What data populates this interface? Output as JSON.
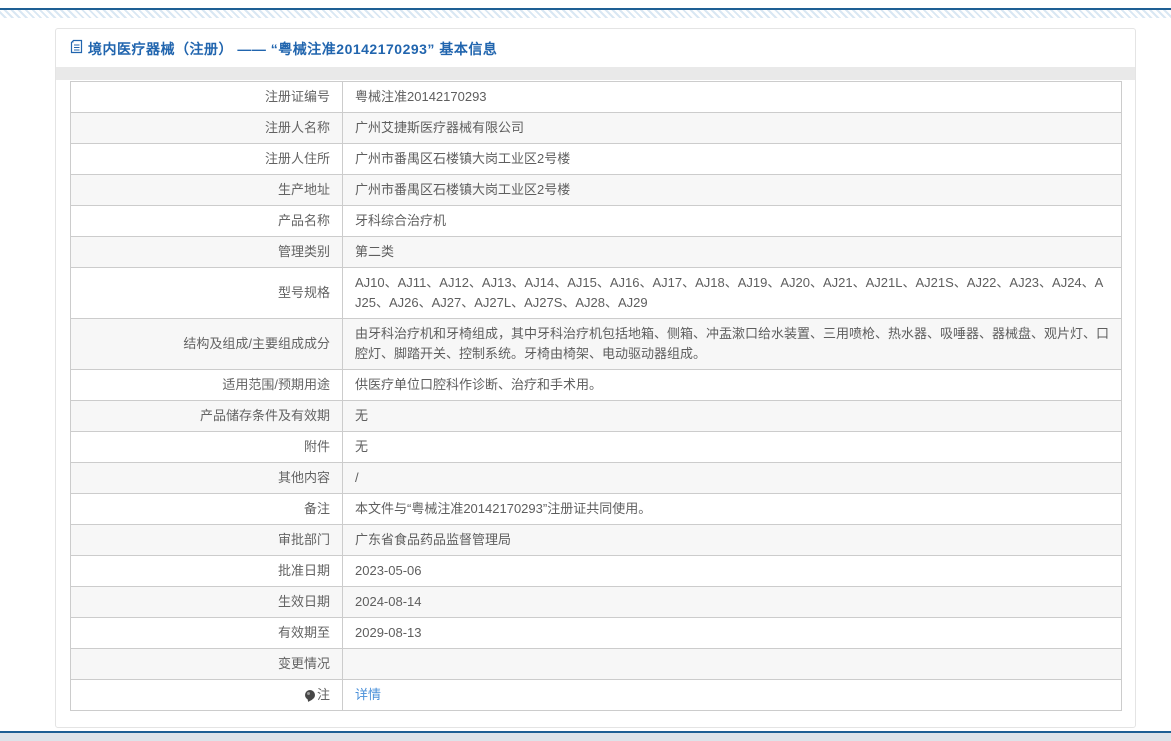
{
  "colors": {
    "accent_blue_line": "#1e5f94",
    "title_blue": "#2165ae",
    "link_blue": "#4a90d9",
    "band_gray": "#e9e9e9",
    "row_alt_gray": "#f7f7f7",
    "table_border": "#cccccc"
  },
  "header": {
    "icon": "document-icon",
    "title": "境内医疗器械（注册） —— “粤械注准20142170293” 基本信息"
  },
  "table": {
    "rows": [
      {
        "label": "注册证编号",
        "value": "粤械注准20142170293"
      },
      {
        "label": "注册人名称",
        "value": "广州艾捷斯医疗器械有限公司"
      },
      {
        "label": "注册人住所",
        "value": "广州市番禺区石楼镇大岗工业区2号楼"
      },
      {
        "label": "生产地址",
        "value": "广州市番禺区石楼镇大岗工业区2号楼"
      },
      {
        "label": "产品名称",
        "value": "牙科综合治疗机"
      },
      {
        "label": "管理类别",
        "value": "第二类"
      },
      {
        "label": "型号规格",
        "value": "AJ10、AJ11、AJ12、AJ13、AJ14、AJ15、AJ16、AJ17、AJ18、AJ19、AJ20、AJ21、AJ21L、AJ21S、AJ22、AJ23、AJ24、AJ25、AJ26、AJ27、AJ27L、AJ27S、AJ28、AJ29"
      },
      {
        "label": "结构及组成/主要组成成分",
        "value": "由牙科治疗机和牙椅组成，其中牙科治疗机包括地箱、侧箱、冲盂漱口给水装置、三用喷枪、热水器、吸唾器、器械盘、观片灯、口腔灯、脚踏开关、控制系统。牙椅由椅架、电动驱动器组成。"
      },
      {
        "label": "适用范围/预期用途",
        "value": "供医疗单位口腔科作诊断、治疗和手术用。"
      },
      {
        "label": "产品储存条件及有效期",
        "value": "无"
      },
      {
        "label": "附件",
        "value": "无"
      },
      {
        "label": "其他内容",
        "value": "/"
      },
      {
        "label": "备注",
        "value": "本文件与“粤械注准20142170293”注册证共同使用。"
      },
      {
        "label": "审批部门",
        "value": "广东省食品药品监督管理局"
      },
      {
        "label": "批准日期",
        "value": "2023-05-06"
      },
      {
        "label": "生效日期",
        "value": "2024-08-14"
      },
      {
        "label": "有效期至",
        "value": "2029-08-13"
      },
      {
        "label": "变更情况",
        "value": ""
      },
      {
        "label": "注",
        "value": "详情",
        "icon": "note-icon",
        "link": true
      }
    ]
  }
}
